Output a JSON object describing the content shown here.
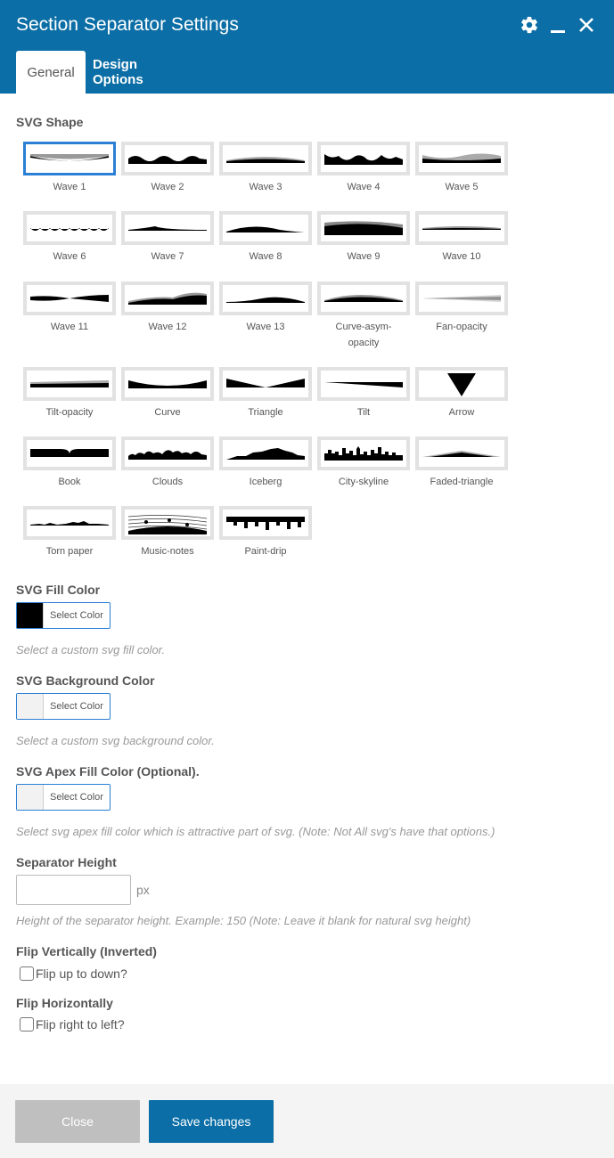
{
  "dialog": {
    "title": "Section Separator Settings",
    "icons": [
      "gear-icon",
      "minimize-icon",
      "close-icon"
    ]
  },
  "tabs": [
    {
      "label": "General",
      "active": true
    },
    {
      "label": "Design Options",
      "active": false
    }
  ],
  "svg_shape": {
    "label": "SVG Shape",
    "selected": "Wave 1",
    "shapes": [
      "Wave 1",
      "Wave 2",
      "Wave 3",
      "Wave 4",
      "Wave 5",
      "Wave 6",
      "Wave 7",
      "Wave 8",
      "Wave 9",
      "Wave 10",
      "Wave 11",
      "Wave 12",
      "Wave 13",
      "Curve-asym-opacity",
      "Fan-opacity",
      "Tilt-opacity",
      "Curve",
      "Triangle",
      "Tilt",
      "Arrow",
      "Book",
      "Clouds",
      "Iceberg",
      "City-skyline",
      "Faded-triangle",
      "Torn paper",
      "Music-notes",
      "Paint-drip"
    ]
  },
  "fill_color": {
    "label": "SVG Fill Color",
    "button": "Select Color",
    "value": "#000000",
    "hint": "Select a custom svg fill color."
  },
  "background_color": {
    "label": "SVG Background Color",
    "button": "Select Color",
    "hint": "Select a custom svg background color."
  },
  "apex_color": {
    "label": "SVG Apex Fill Color (Optional).",
    "button": "Select Color",
    "hint": "Select svg apex fill color which is attractive part of svg. (Note: Not All svg's have that options.)"
  },
  "separator_height": {
    "label": "Separator Height",
    "value": "",
    "unit": "px",
    "hint": "Height of the separator height. Example: 150 (Note: Leave it blank for natural svg height)"
  },
  "flip_vertical": {
    "label": "Flip Vertically (Inverted)",
    "option": "Flip up to down?",
    "checked": false
  },
  "flip_horizontal": {
    "label": "Flip Horizontally",
    "option": "Flip right to left?",
    "checked": false
  },
  "footer": {
    "close_label": "Close",
    "save_label": "Save changes"
  },
  "colors": {
    "header": "#0b6ea6",
    "selected_border": "#2b7fd4",
    "close_button": "#bfbfbf",
    "save_button": "#0b6ea6"
  }
}
